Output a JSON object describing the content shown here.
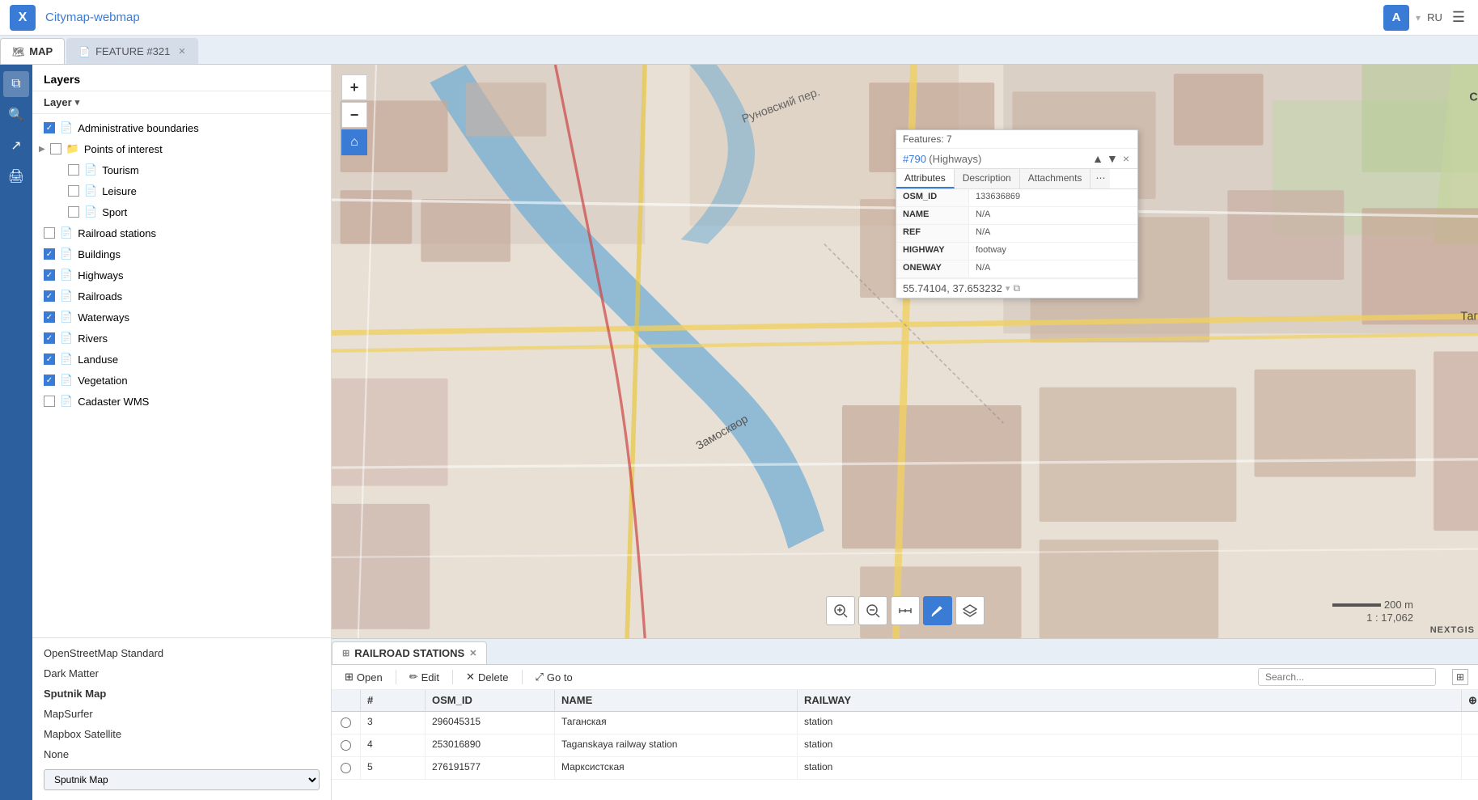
{
  "app": {
    "title": "Citymap-webmap",
    "logo": "X"
  },
  "topbar": {
    "avatar": "A",
    "lang": "RU",
    "hamburger": "☰"
  },
  "tabs": [
    {
      "id": "map",
      "icon": "🗺",
      "label": "MAP",
      "active": true,
      "closable": false
    },
    {
      "id": "feature",
      "icon": "📄",
      "label": "FEATURE #321",
      "active": false,
      "closable": true
    }
  ],
  "sidebar_icons": [
    {
      "name": "layers-icon",
      "icon": "⧉",
      "active": true
    },
    {
      "name": "search-icon",
      "icon": "🔍",
      "active": false
    },
    {
      "name": "share-icon",
      "icon": "↗",
      "active": false
    },
    {
      "name": "print-icon",
      "icon": "🖨",
      "active": false
    }
  ],
  "layers_panel": {
    "title": "Layers",
    "filter_label": "Layer",
    "items": [
      {
        "id": "admin",
        "name": "Administrative boundaries",
        "level": 0,
        "checked": true,
        "type": "layer"
      },
      {
        "id": "poi_group",
        "name": "Points of interest",
        "level": 0,
        "checked": false,
        "type": "group",
        "expanded": false
      },
      {
        "id": "tourism",
        "name": "Tourism",
        "level": 1,
        "checked": false,
        "type": "layer"
      },
      {
        "id": "leisure",
        "name": "Leisure",
        "level": 1,
        "checked": false,
        "type": "layer"
      },
      {
        "id": "sport",
        "name": "Sport",
        "level": 1,
        "checked": false,
        "type": "layer"
      },
      {
        "id": "railroad_stations",
        "name": "Railroad stations",
        "level": 0,
        "checked": false,
        "type": "layer"
      },
      {
        "id": "buildings",
        "name": "Buildings",
        "level": 0,
        "checked": true,
        "type": "layer"
      },
      {
        "id": "highways",
        "name": "Highways",
        "level": 0,
        "checked": true,
        "type": "layer"
      },
      {
        "id": "railroads",
        "name": "Railroads",
        "level": 0,
        "checked": true,
        "type": "layer"
      },
      {
        "id": "waterways",
        "name": "Waterways",
        "level": 0,
        "checked": true,
        "type": "layer"
      },
      {
        "id": "rivers",
        "name": "Rivers",
        "level": 0,
        "checked": true,
        "type": "layer"
      },
      {
        "id": "landuse",
        "name": "Landuse",
        "level": 0,
        "checked": true,
        "type": "layer"
      },
      {
        "id": "vegetation",
        "name": "Vegetation",
        "level": 0,
        "checked": true,
        "type": "layer"
      },
      {
        "id": "cadaster",
        "name": "Cadaster WMS",
        "level": 0,
        "checked": false,
        "type": "layer"
      }
    ]
  },
  "basemaps": {
    "items": [
      {
        "id": "osm",
        "name": "OpenStreetMap Standard",
        "bold": false
      },
      {
        "id": "dark",
        "name": "Dark Matter",
        "bold": false
      },
      {
        "id": "sputnik",
        "name": "Sputnik Map",
        "bold": true
      },
      {
        "id": "mapsurfer",
        "name": "MapSurfer",
        "bold": false
      },
      {
        "id": "mapbox",
        "name": "Mapbox Satellite",
        "bold": false
      },
      {
        "id": "none",
        "name": "None",
        "bold": false
      }
    ],
    "selected": "Sputnik Map"
  },
  "map_controls": {
    "zoom_in": "+",
    "zoom_out": "−",
    "home": "⌂"
  },
  "feature_popup": {
    "feature_count_label": "Features: 7",
    "feature_number": "#790",
    "feature_type": "(Highways)",
    "tabs": [
      "Attributes",
      "Description",
      "Attachments"
    ],
    "active_tab": "Attributes",
    "attributes": [
      {
        "key": "OSM_ID",
        "value": "133636869"
      },
      {
        "key": "NAME",
        "value": "N/A"
      },
      {
        "key": "REF",
        "value": "N/A"
      },
      {
        "key": "HIGHWAY",
        "value": "footway"
      },
      {
        "key": "ONEWAY",
        "value": "N/A"
      }
    ],
    "coordinates": "55.74104, 37.653232",
    "close": "×"
  },
  "bottom_tools": [
    {
      "id": "zoom-in-tool",
      "icon": "🔍+",
      "label": "zoom in"
    },
    {
      "id": "zoom-out-tool",
      "icon": "🔍-",
      "label": "zoom out"
    },
    {
      "id": "measure-tool",
      "icon": "📏",
      "label": "measure"
    },
    {
      "id": "edit-tool",
      "icon": "✏",
      "label": "edit",
      "active": true
    },
    {
      "id": "layers-tool",
      "icon": "⧉",
      "label": "layers"
    }
  ],
  "map_scale": {
    "label": "200 m",
    "ratio": "1 : 17,062"
  },
  "table_panel": {
    "tab_label": "RAILROAD STATIONS",
    "toolbar": {
      "open": "Open",
      "edit": "Edit",
      "delete": "Delete",
      "goto": "Go to"
    },
    "search_placeholder": "Search...",
    "columns": [
      "#",
      "OSM_ID",
      "NAME",
      "RAILWAY"
    ],
    "rows": [
      {
        "id": 3,
        "osm_id": "296045315",
        "name": "Таганская",
        "railway": "station"
      },
      {
        "id": 4,
        "osm_id": "253016890",
        "name": "Taganskaya railway station",
        "railway": "station"
      },
      {
        "id": 5,
        "osm_id": "276191577",
        "name": "Марксистская",
        "railway": "station"
      }
    ]
  }
}
